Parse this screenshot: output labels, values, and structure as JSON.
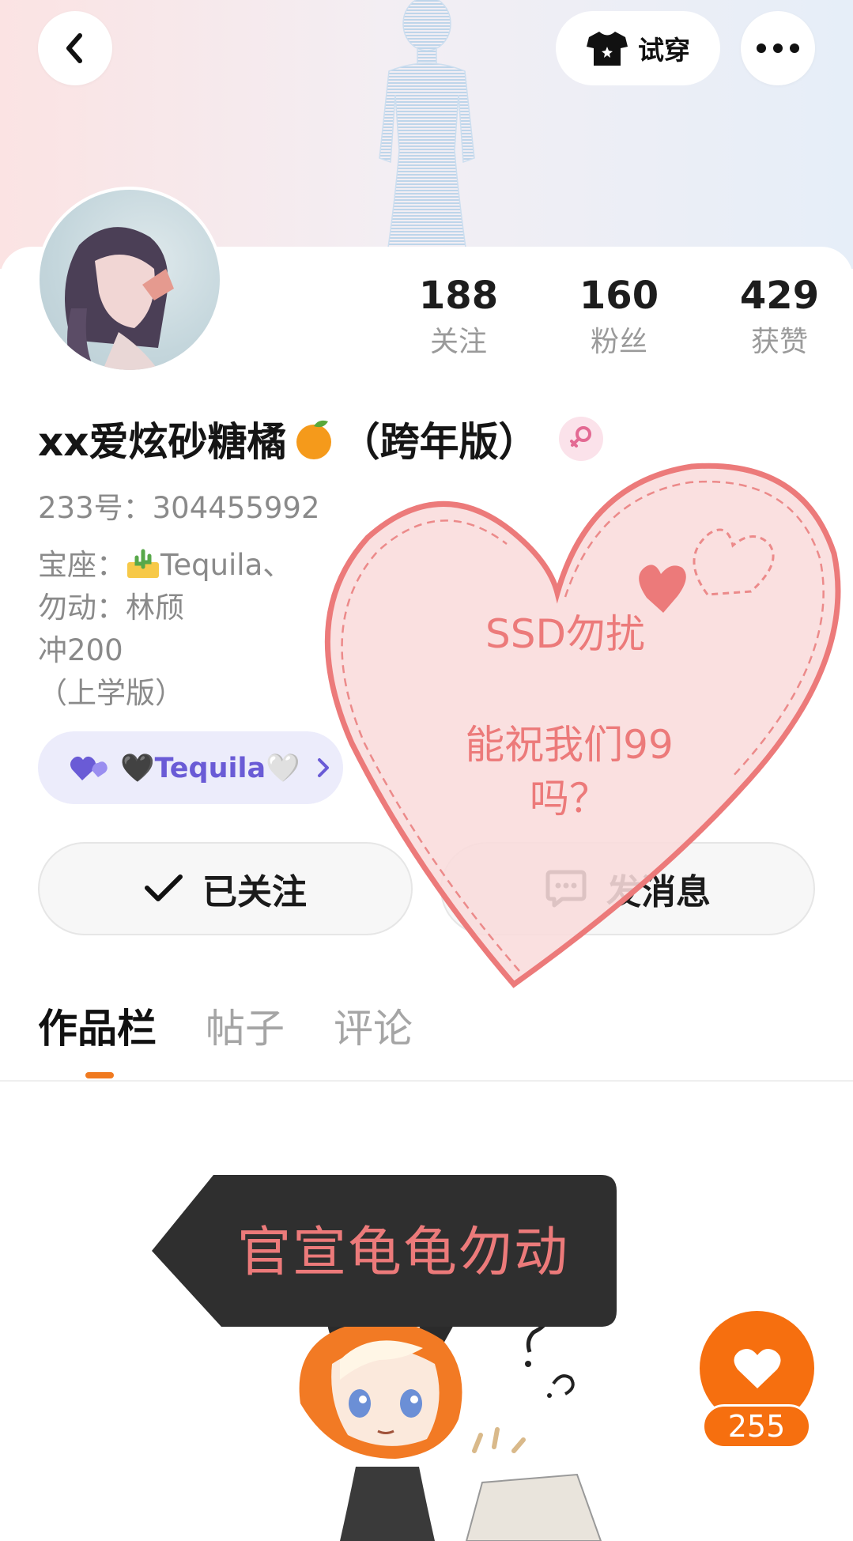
{
  "header": {
    "back_icon": "chevron-left-icon",
    "tryon_label": "试穿",
    "tryon_icon": "tshirt-icon",
    "more_icon": "more-dots-icon"
  },
  "profile": {
    "nickname_part1": "xx爱炫砂糖橘",
    "nickname_part2": "（跨年版）",
    "gender_icon": "female-icon",
    "uid": "233号：304455992",
    "bio_line1_prefix": "宝座：",
    "bio_line1_suffix": "Tequila、",
    "bio_line2": "勿动：林颀",
    "bio_line3": "冲200",
    "bio_line4": "（上学版）",
    "tag_label": "🖤Tequila🤍"
  },
  "stats": [
    {
      "value": "188",
      "label": "关注"
    },
    {
      "value": "160",
      "label": "粉丝"
    },
    {
      "value": "429",
      "label": "获赞"
    }
  ],
  "actions": {
    "follow_label": "已关注",
    "message_label": "发消息"
  },
  "overlay": {
    "heart_line1": "SSD勿扰",
    "heart_line2": "能祝我们99",
    "heart_line3": "吗？"
  },
  "tabs": [
    {
      "label": "作品栏",
      "active": true
    },
    {
      "label": "帖子",
      "active": false
    },
    {
      "label": "评论",
      "active": false
    }
  ],
  "post": {
    "caption": "官宣龟龟勿动",
    "like_count": "255"
  },
  "colors": {
    "accent_orange": "#f66f0f",
    "heart_pink": "#ec7a7a",
    "tag_purple": "#6a5bd6"
  }
}
